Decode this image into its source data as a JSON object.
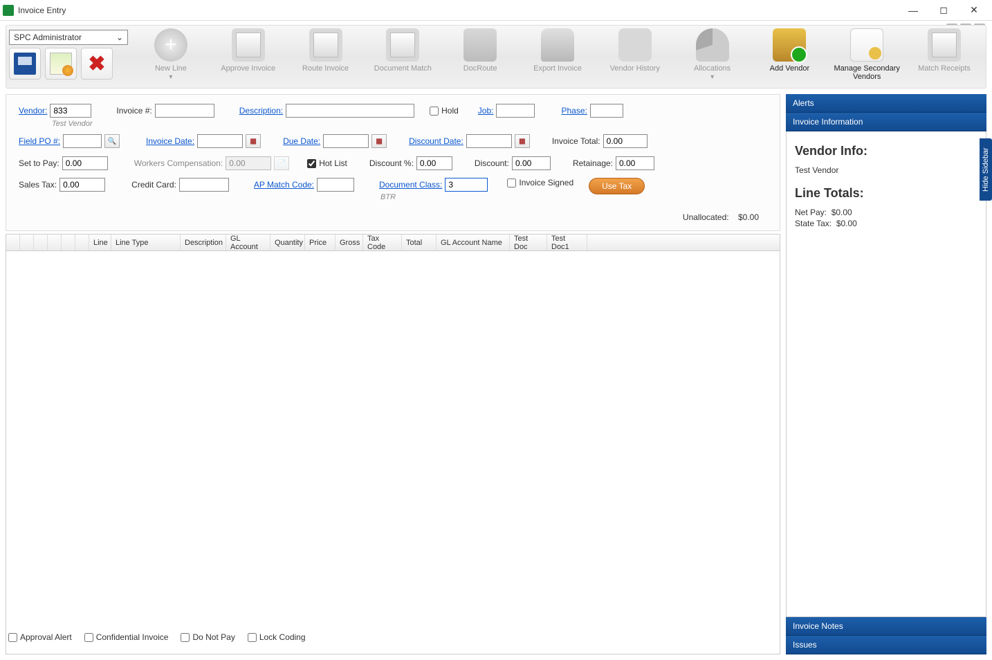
{
  "window": {
    "title": "Invoice Entry"
  },
  "user_dropdown": "SPC Administrator",
  "ribbon": [
    {
      "label": "New Line",
      "style": "newline",
      "active": false,
      "expand": true
    },
    {
      "label": "Approve Invoice",
      "style": "approve",
      "active": false
    },
    {
      "label": "Route Invoice",
      "style": "route",
      "active": false
    },
    {
      "label": "Document Match",
      "style": "docmatch",
      "active": false
    },
    {
      "label": "DocRoute",
      "style": "docroute",
      "active": false
    },
    {
      "label": "Export Invoice",
      "style": "export",
      "active": false
    },
    {
      "label": "Vendor History",
      "style": "history",
      "active": false
    },
    {
      "label": "Allocations",
      "style": "alloc",
      "active": false,
      "expand": true
    },
    {
      "label": "Add Vendor",
      "style": "addvendor",
      "active": true
    },
    {
      "label": "Manage Secondary Vendors",
      "style": "secondary",
      "active": true
    },
    {
      "label": "Match Receipts",
      "style": "receipt",
      "active": false
    }
  ],
  "form": {
    "vendor_label": "Vendor:",
    "vendor": "833",
    "vendor_sub": "Test Vendor",
    "invoice_num_label": "Invoice #:",
    "invoice_num": "",
    "description_label": "Description:",
    "description": "",
    "hold_label": "Hold",
    "hold": false,
    "job_label": "Job:",
    "job": "",
    "phase_label": "Phase:",
    "phase": "",
    "field_po_label": "Field PO #:",
    "field_po": "",
    "invoice_date_label": "Invoice Date:",
    "invoice_date": "",
    "due_date_label": "Due Date:",
    "due_date": "",
    "discount_date_label": "Discount Date:",
    "discount_date": "",
    "invoice_total_label": "Invoice Total:",
    "invoice_total": "0.00",
    "set_to_pay_label": "Set to Pay:",
    "set_to_pay": "0.00",
    "workers_comp_label": "Workers Compensation:",
    "workers_comp": "0.00",
    "hot_list_label": "Hot List",
    "hot_list": true,
    "discount_pct_label": "Discount %:",
    "discount_pct": "0.00",
    "discount_label": "Discount:",
    "discount": "0.00",
    "retainage_label": "Retainage:",
    "retainage": "0.00",
    "sales_tax_label": "Sales Tax:",
    "sales_tax": "0.00",
    "credit_card_label": "Credit Card:",
    "credit_card": "",
    "ap_match_label": "AP Match Code:",
    "ap_match": "",
    "doc_class_label": "Document Class:",
    "doc_class": "3",
    "doc_class_sub": "BTR",
    "invoice_signed_label": "Invoice Signed",
    "invoice_signed": false,
    "use_tax_btn": "Use Tax"
  },
  "unallocated": {
    "label": "Unallocated:",
    "value": "$0.00"
  },
  "grid_headers": [
    "Line",
    "Line Type",
    "Description",
    "GL Account",
    "Quantity",
    "Price",
    "Gross",
    "Tax Code",
    "Total",
    "GL Account Name",
    "Test Doc",
    "Test Doc1"
  ],
  "sidebar": {
    "alerts": "Alerts",
    "info_header": "Invoice Information",
    "vendor_info_title": "Vendor Info:",
    "vendor_name": "Test Vendor",
    "line_totals_title": "Line Totals:",
    "net_pay_label": "Net Pay:",
    "net_pay": "$0.00",
    "state_tax_label": "State Tax:",
    "state_tax": "$0.00",
    "notes_header": "Invoice Notes",
    "issues_header": "Issues",
    "hide_tab": "Hide Sidebar"
  },
  "footer": [
    {
      "label": "Approval Alert",
      "checked": false
    },
    {
      "label": "Confidential Invoice",
      "checked": false
    },
    {
      "label": "Do Not Pay",
      "checked": false
    },
    {
      "label": "Lock Coding",
      "checked": false
    }
  ]
}
